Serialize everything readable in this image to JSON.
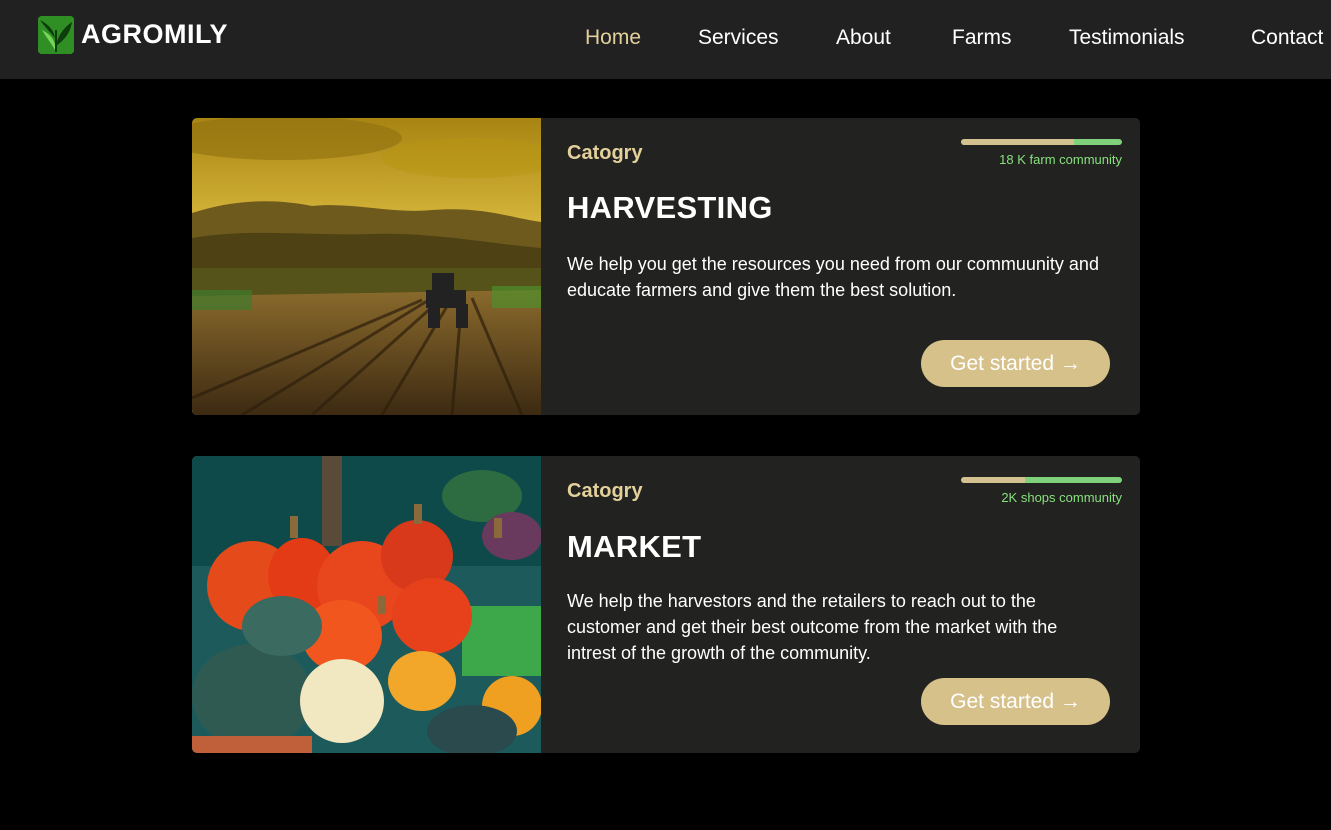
{
  "brand": {
    "name": "AGROMILY"
  },
  "nav": {
    "items": [
      {
        "label": "Home",
        "active": true
      },
      {
        "label": "Services"
      },
      {
        "label": "About"
      },
      {
        "label": "Farms"
      },
      {
        "label": "Testimonials"
      },
      {
        "label": "Contact"
      }
    ]
  },
  "colors": {
    "accent": "#e3d09b",
    "button": "#d6c18b",
    "community_green": "#87e07e",
    "card_bg": "#222220",
    "nav_bg": "#212121"
  },
  "cards": [
    {
      "category": "Catogry",
      "title": "HARVESTING",
      "description": "We help you get the resources you need from our commuunity and educate farmers and give them the best solution.",
      "community": "18 K farm community",
      "progress": 0.7,
      "button": "Get started →",
      "image_icon": "tractor-field-photo"
    },
    {
      "category": "Catogry",
      "title": "MARKET",
      "description": "We help the harvestors and the retailers to reach out to the customer and get their best outcome from the market with the intrest of the growth of the community.",
      "community": "2K shops community",
      "progress": 0.4,
      "button": "Get started →",
      "image_icon": "pumpkins-market-photo"
    }
  ]
}
